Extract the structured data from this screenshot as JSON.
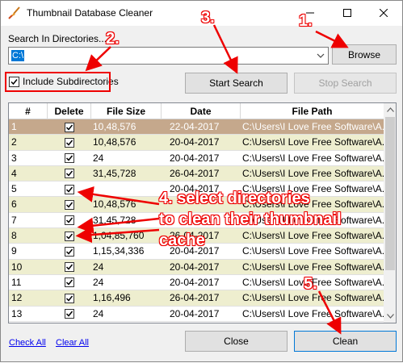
{
  "window": {
    "title": "Thumbnail Database Cleaner",
    "icon": "broom-icon"
  },
  "search": {
    "label": "Search In Directories...",
    "value": "C:\\",
    "browse_label": "Browse",
    "include_subdirs_label": "Include Subdirectories",
    "include_subdirs_checked": true,
    "start_label": "Start Search",
    "stop_label": "Stop Search"
  },
  "grid": {
    "columns": [
      "#",
      "Delete",
      "File Size",
      "Date",
      "File Path"
    ],
    "rows": [
      {
        "num": "1",
        "checked": true,
        "size": "10,48,576",
        "date": "22-04-2017",
        "path": "C:\\Users\\I Love Free Software\\A..."
      },
      {
        "num": "2",
        "checked": true,
        "size": "10,48,576",
        "date": "20-04-2017",
        "path": "C:\\Users\\I Love Free Software\\A..."
      },
      {
        "num": "3",
        "checked": true,
        "size": "24",
        "date": "20-04-2017",
        "path": "C:\\Users\\I Love Free Software\\A..."
      },
      {
        "num": "4",
        "checked": true,
        "size": "31,45,728",
        "date": "26-04-2017",
        "path": "C:\\Users\\I Love Free Software\\A..."
      },
      {
        "num": "5",
        "checked": true,
        "size": "",
        "date": "20-04-2017",
        "path": "C:\\Users\\I Love Free Software\\A..."
      },
      {
        "num": "6",
        "checked": true,
        "size": "10,48,576",
        "date": "",
        "path": "C:\\Users\\I Love Free Software\\A..."
      },
      {
        "num": "7",
        "checked": true,
        "size": "31,45,728",
        "date": "",
        "path": "C:\\Users\\I Love Free Software\\A..."
      },
      {
        "num": "8",
        "checked": true,
        "size": "1,04,85,760",
        "date": "26-04-2017",
        "path": "C:\\Users\\I Love Free Software\\A..."
      },
      {
        "num": "9",
        "checked": true,
        "size": "1,15,34,336",
        "date": "20-04-2017",
        "path": "C:\\Users\\I Love Free Software\\A..."
      },
      {
        "num": "10",
        "checked": true,
        "size": "24",
        "date": "20-04-2017",
        "path": "C:\\Users\\I Love Free Software\\A..."
      },
      {
        "num": "11",
        "checked": true,
        "size": "24",
        "date": "20-04-2017",
        "path": "C:\\Users\\I Love Free Software\\A..."
      },
      {
        "num": "12",
        "checked": true,
        "size": "1,16,496",
        "date": "26-04-2017",
        "path": "C:\\Users\\I Love Free Software\\A..."
      },
      {
        "num": "13",
        "checked": true,
        "size": "24",
        "date": "20-04-2017",
        "path": "C:\\Users\\I Love Free Software\\A..."
      }
    ],
    "selected_row": "1"
  },
  "footer": {
    "check_all": "Check All",
    "clear_all": "Clear All",
    "close_label": "Close",
    "clean_label": "Clean"
  },
  "annotations": {
    "step1": "1.",
    "step2": "2.",
    "step3": "3.",
    "step4_line1": "4. select directories",
    "step4_line2": "to clean their thumbnail",
    "step4_line3": "cache",
    "step5": "5."
  },
  "colors": {
    "annotation_red": "#ee0000",
    "selected_row": "#c5a88c",
    "alt_row": "#eeeecf"
  }
}
